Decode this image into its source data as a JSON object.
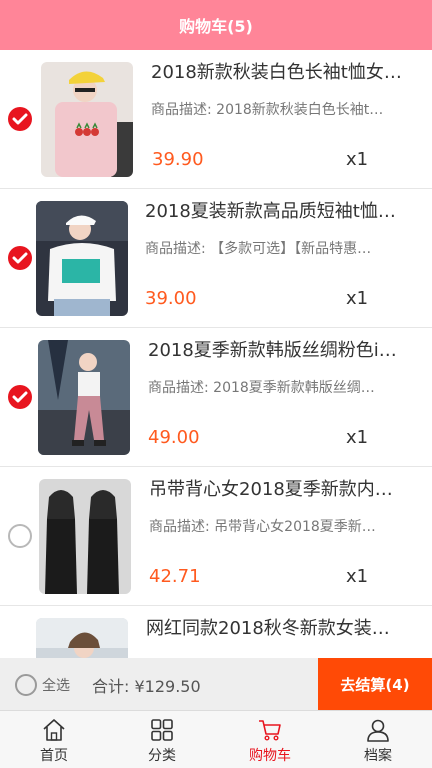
{
  "header": {
    "title": "购物车(5)"
  },
  "colors": {
    "accent": "#ff8598",
    "price": "#ff5a1f",
    "checked": "#e8151f",
    "checkout": "#ff4a06"
  },
  "items": [
    {
      "title": "2018新款秋装白色长袖t恤女…",
      "desc": "商品描述: 2018新款秋装白色长袖t…",
      "price": "39.90",
      "qty": "x1",
      "checked": true
    },
    {
      "title": "2018夏装新款高品质短袖t恤…",
      "desc": "商品描述: 【多款可选】【新品特惠…",
      "price": "39.00",
      "qty": "x1",
      "checked": true
    },
    {
      "title": "2018夏季新款韩版丝绸粉色i…",
      "desc": "商品描述: 2018夏季新款韩版丝绸…",
      "price": "49.00",
      "qty": "x1",
      "checked": true
    },
    {
      "title": "吊带背心女2018夏季新款内…",
      "desc": "商品描述: 吊带背心女2018夏季新…",
      "price": "42.71",
      "qty": "x1",
      "checked": false
    },
    {
      "title": "网红同款2018秋冬新款女装…",
      "desc": "",
      "price": "",
      "qty": "",
      "checked": false
    }
  ],
  "footer": {
    "select_all": "全选",
    "total": "合计: ¥129.50",
    "checkout": "去结算(4)"
  },
  "tabs": [
    {
      "label": "首页",
      "icon": "home-icon",
      "active": false
    },
    {
      "label": "分类",
      "icon": "grid-icon",
      "active": false
    },
    {
      "label": "购物车",
      "icon": "cart-icon",
      "active": true
    },
    {
      "label": "档案",
      "icon": "user-icon",
      "active": false
    }
  ]
}
